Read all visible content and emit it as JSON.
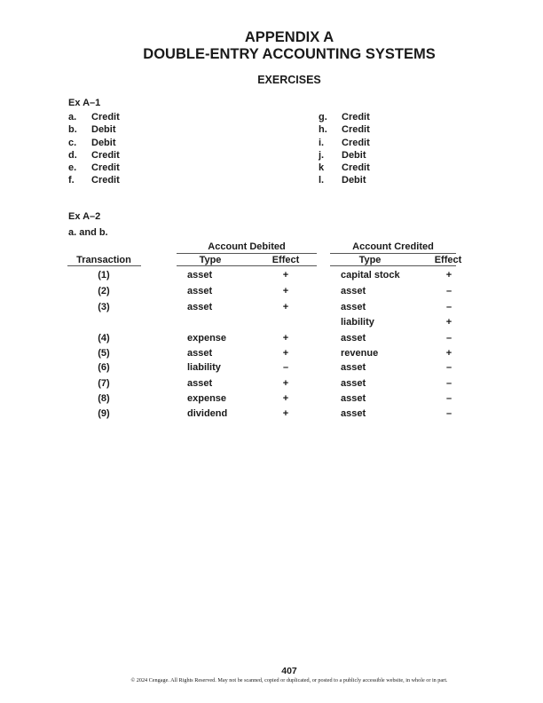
{
  "header": {
    "title_line1": "APPENDIX A",
    "title_line2": "DOUBLE-ENTRY ACCOUNTING SYSTEMS",
    "section": "EXERCISES"
  },
  "ex_a1": {
    "heading": "Ex A–1",
    "left": [
      {
        "label": "a.",
        "value": "Credit"
      },
      {
        "label": "b.",
        "value": "Debit"
      },
      {
        "label": "c.",
        "value": "Debit"
      },
      {
        "label": "d.",
        "value": "Credit"
      },
      {
        "label": "e.",
        "value": "Credit"
      },
      {
        "label": "f.",
        "value": "Credit"
      }
    ],
    "right": [
      {
        "label": "g.",
        "value": "Credit"
      },
      {
        "label": "h.",
        "value": "Credit"
      },
      {
        "label": "i.",
        "value": "Credit"
      },
      {
        "label": "j.",
        "value": "Debit"
      },
      {
        "label": "k",
        "value": "Credit"
      },
      {
        "label": "l.",
        "value": "Debit"
      }
    ]
  },
  "ex_a2": {
    "heading": "Ex A–2",
    "subheading": "a. and b.",
    "group_debited": "Account Debited",
    "group_credited": "Account Credited",
    "col_transaction": "Transaction",
    "col_type": "Type",
    "col_effect": "Effect",
    "rows": [
      {
        "txn": "(1)",
        "deb_type": "asset",
        "deb_effect": "+",
        "cred_type": "capital stock",
        "cred_effect": "+"
      },
      {
        "txn": "(2)",
        "deb_type": "asset",
        "deb_effect": "+",
        "cred_type": "asset",
        "cred_effect": "–"
      },
      {
        "txn": "(3)",
        "deb_type": "asset",
        "deb_effect": "+",
        "cred_type": "asset",
        "cred_effect": "–"
      },
      {
        "txn": "",
        "deb_type": "",
        "deb_effect": "",
        "cred_type": "liability",
        "cred_effect": "+"
      },
      {
        "txn": "(4)",
        "deb_type": "expense",
        "deb_effect": "+",
        "cred_type": "asset",
        "cred_effect": "–"
      },
      {
        "txn": "(5)",
        "deb_type": "asset",
        "deb_effect": "+",
        "cred_type": "revenue",
        "cred_effect": "+"
      },
      {
        "txn": "(6)",
        "deb_type": "liability",
        "deb_effect": "–",
        "cred_type": "asset",
        "cred_effect": "–"
      },
      {
        "txn": "(7)",
        "deb_type": "asset",
        "deb_effect": "+",
        "cred_type": "asset",
        "cred_effect": "–"
      },
      {
        "txn": "(8)",
        "deb_type": "expense",
        "deb_effect": "+",
        "cred_type": "asset",
        "cred_effect": "–"
      },
      {
        "txn": "(9)",
        "deb_type": "dividend",
        "deb_effect": "+",
        "cred_type": "asset",
        "cred_effect": "–"
      }
    ]
  },
  "footer": {
    "page_number": "407",
    "copyright": "© 2024 Cengage. All Rights Reserved. May not be scanned, copied or duplicated, or posted to a publicly accessible website, in whole or in part."
  }
}
